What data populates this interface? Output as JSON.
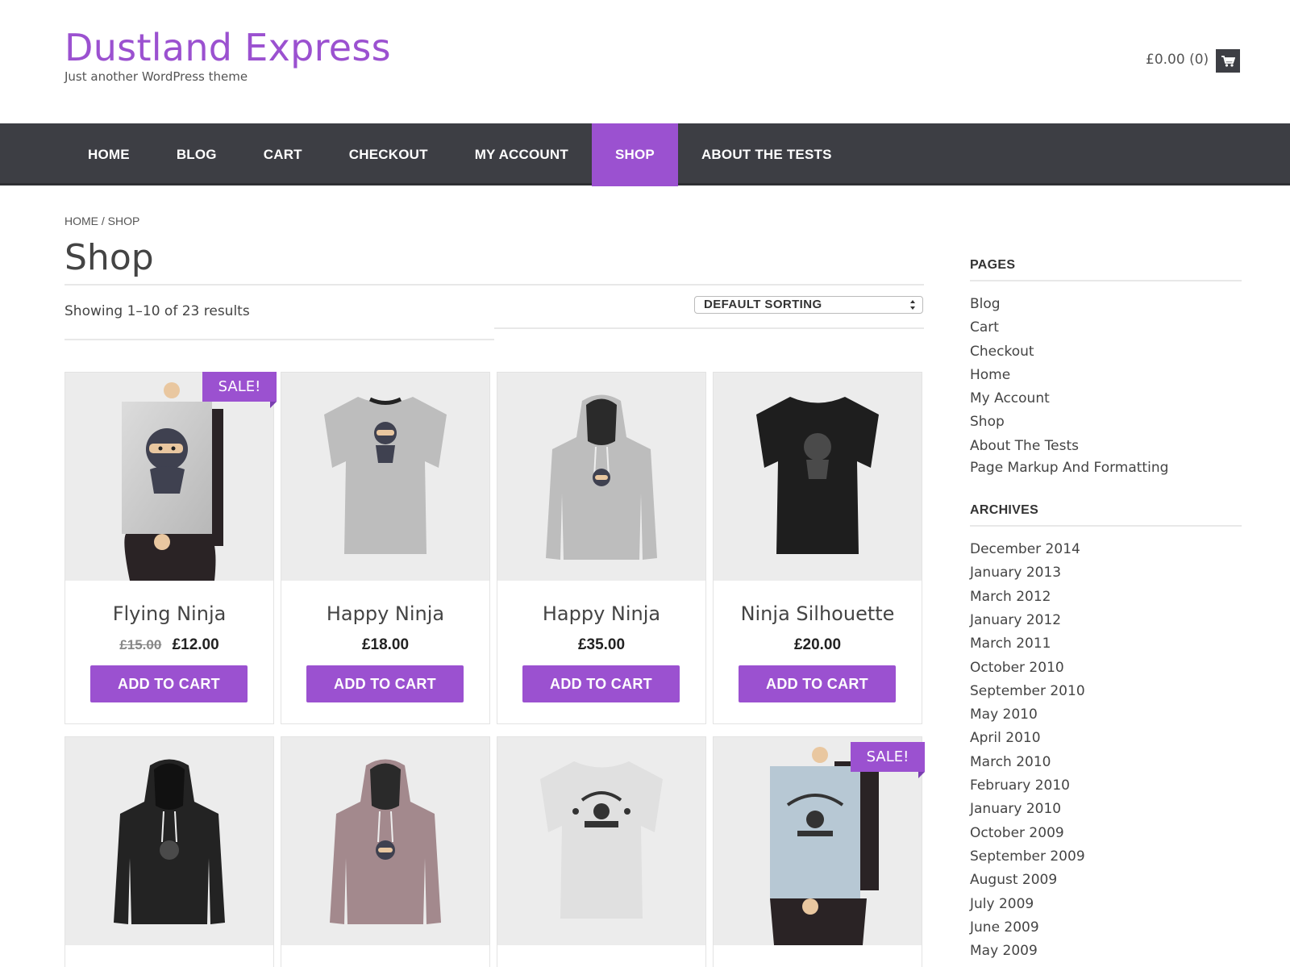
{
  "header": {
    "site_title": "Dustland Express",
    "tagline": "Just another WordPress theme",
    "cart_summary": "£0.00 (0)",
    "cart_icon": "shopping-cart-icon"
  },
  "nav": {
    "items": [
      {
        "label": "HOME",
        "active": false
      },
      {
        "label": "BLOG",
        "active": false
      },
      {
        "label": "CART",
        "active": false
      },
      {
        "label": "CHECKOUT",
        "active": false
      },
      {
        "label": "MY ACCOUNT",
        "active": false
      },
      {
        "label": "SHOP",
        "active": true
      },
      {
        "label": "ABOUT THE TESTS",
        "active": false
      }
    ]
  },
  "breadcrumb": "HOME / SHOP",
  "page_title": "Shop",
  "result_count": "Showing 1–10 of 23 results",
  "sorting": {
    "selected": "DEFAULT SORTING"
  },
  "colors": {
    "accent": "#9b51d0",
    "nav_bg": "#3d3e44"
  },
  "products": [
    {
      "name": "Flying Ninja",
      "old_price": "£15.00",
      "price": "£12.00",
      "button": "ADD TO CART",
      "sale": "SALE!",
      "image": "ninja-poster-image"
    },
    {
      "name": "Happy Ninja",
      "price": "£18.00",
      "button": "ADD TO CART",
      "image": "grey-ninja-tshirt-image"
    },
    {
      "name": "Happy Ninja",
      "price": "£35.00",
      "button": "ADD TO CART",
      "image": "grey-ninja-hoodie-image"
    },
    {
      "name": "Ninja Silhouette",
      "price": "£20.00",
      "button": "ADD TO CART",
      "image": "black-ninja-tshirt-image"
    },
    {
      "image": "black-hoodie-image"
    },
    {
      "image": "pink-ninja-hoodie-image"
    },
    {
      "image": "woothemes-tshirt-image"
    },
    {
      "sale": "SALE!",
      "image": "woothemes-poster-image"
    }
  ],
  "sidebar": {
    "pages_title": "PAGES",
    "pages": [
      "Blog",
      "Cart",
      "Checkout",
      "Home",
      "My Account",
      "Shop",
      "About The Tests",
      "Page Markup And Formatting"
    ],
    "archives_title": "ARCHIVES",
    "archives": [
      "December 2014",
      "January 2013",
      "March 2012",
      "January 2012",
      "March 2011",
      "October 2010",
      "September 2010",
      "May 2010",
      "April 2010",
      "March 2010",
      "February 2010",
      "January 2010",
      "October 2009",
      "September 2009",
      "August 2009",
      "July 2009",
      "June 2009",
      "May 2009"
    ]
  }
}
